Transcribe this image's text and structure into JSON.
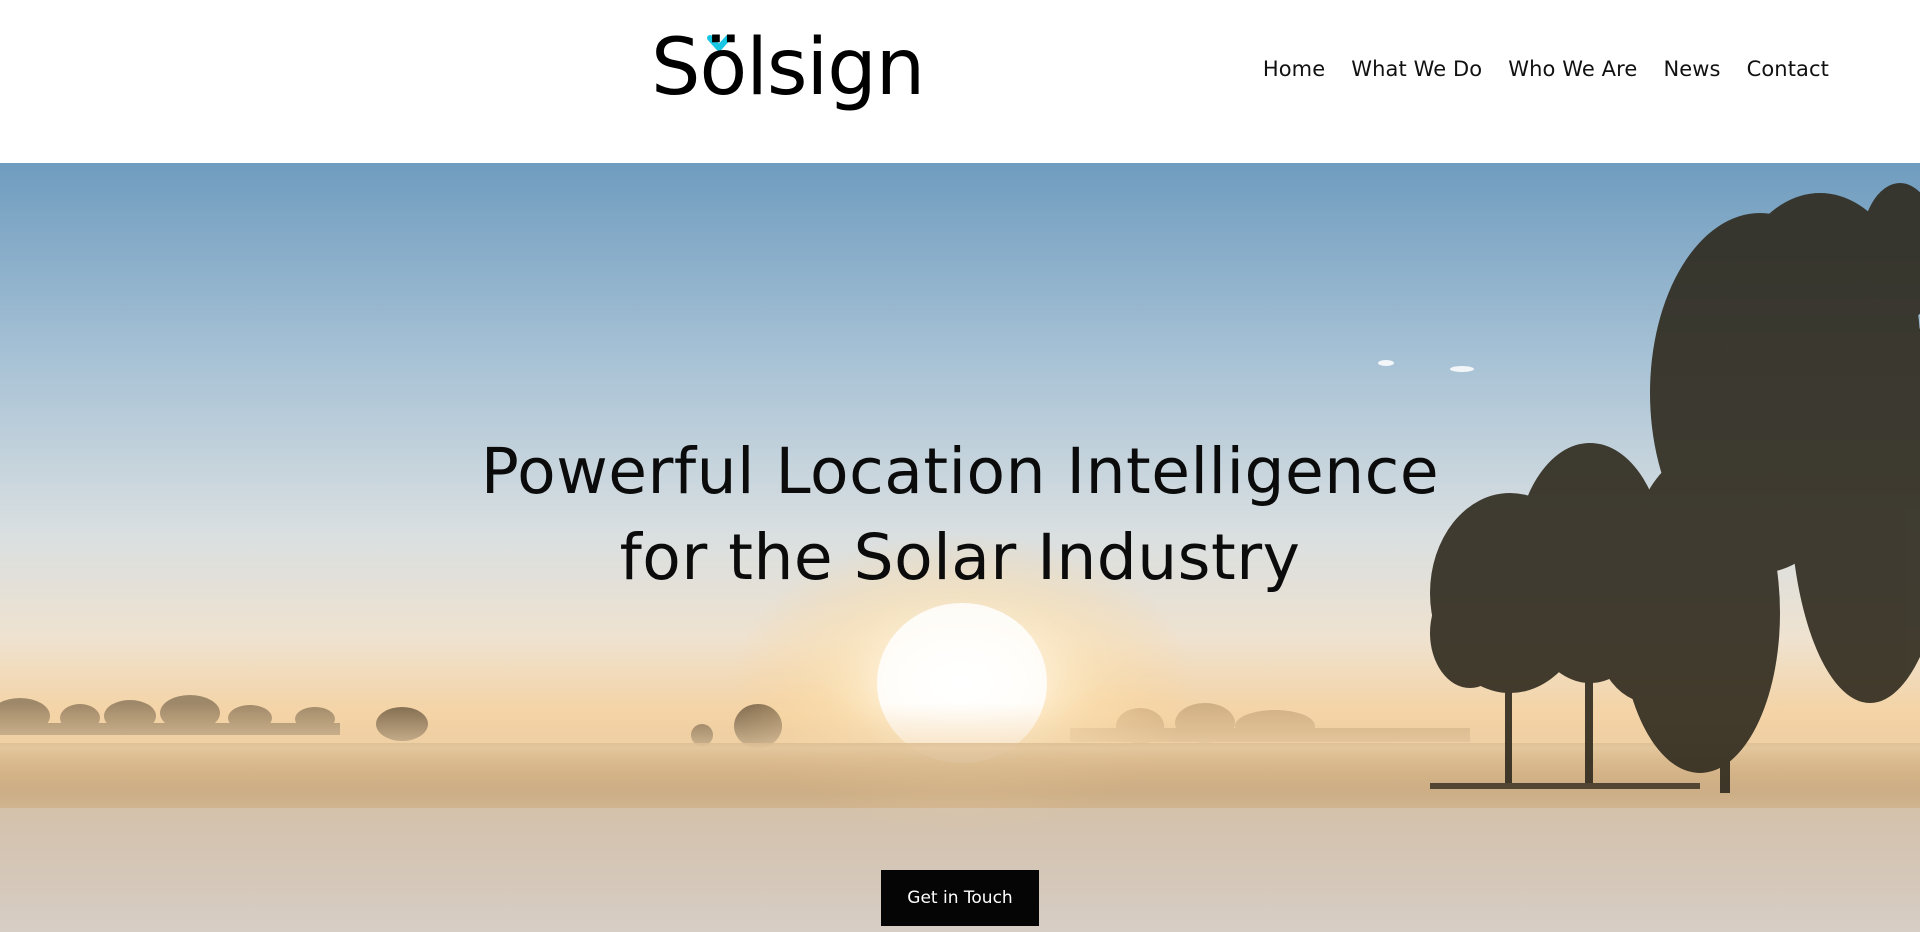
{
  "header": {
    "logo": {
      "text": "Sölsign",
      "accent_color": "#19c7e3"
    },
    "nav": [
      {
        "label": "Home"
      },
      {
        "label": "What We Do"
      },
      {
        "label": "Who We Are"
      },
      {
        "label": "News"
      },
      {
        "label": "Contact"
      }
    ]
  },
  "hero": {
    "title_line_1": "Powerful Location Intelligence",
    "title_line_2": "for the Solar Industry",
    "cta_label": "Get in Touch",
    "background": "sunrise over misty field with trees"
  },
  "colors": {
    "text_dark": "#0b0b0b",
    "button_bg": "#050505",
    "button_text": "#ffffff",
    "logo_accent": "#19c7e3"
  }
}
